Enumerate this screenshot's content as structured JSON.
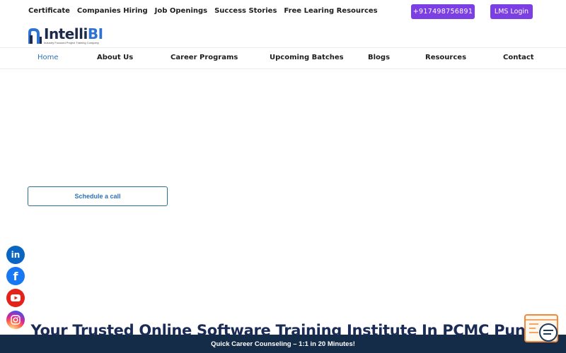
{
  "topbar": {
    "links": [
      "Certificate",
      "Companies Hiring",
      "Job Openings",
      "Success Stories",
      "Free Learing Resources"
    ],
    "phone": "+917498756891",
    "lms_login": "LMS Login"
  },
  "logo": {
    "name_prefix": "Intelli",
    "name_suffix": "BI",
    "tagline": "Industry Focused Project Training Company"
  },
  "nav": {
    "items": [
      "Home",
      "About Us",
      "Career Programs",
      "Upcoming Batches",
      "Blogs",
      "Resources",
      "Contact"
    ],
    "active": "Home"
  },
  "cta": {
    "schedule_label": "Schedule a call"
  },
  "social": {
    "icons": [
      "linkedin-icon",
      "facebook-icon",
      "youtube-icon",
      "instagram-icon"
    ],
    "colors": {
      "linkedin": "#0a66c2",
      "facebook": "#1877f2",
      "youtube": "#e62117"
    }
  },
  "hero": {
    "title": "Your Trusted Online Software Training Institute In PCMC Pune"
  },
  "bottom_bar": {
    "text": "Quick Career Counseling – 1:1 in 20 Minutes!"
  },
  "colors": {
    "accent_purple": "#7b3fe4",
    "nav_active": "#2e72b8",
    "dark_navy": "#152c49"
  }
}
